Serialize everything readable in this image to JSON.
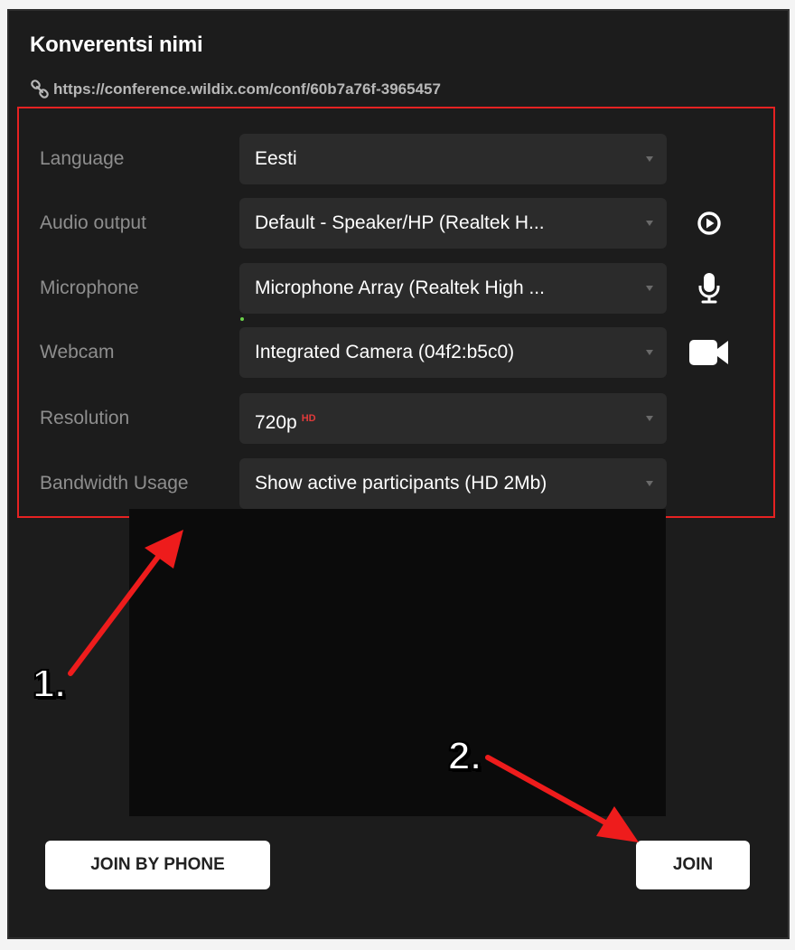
{
  "header": {
    "title": "Konverentsi nimi",
    "link_icon": "link-icon",
    "link_url": "https://conference.wildix.com/conf/60b7a76f-3965457"
  },
  "settings": {
    "rows": [
      {
        "label": "Language",
        "value": "Eesti"
      },
      {
        "label": "Audio output",
        "value": "Default - Speaker/HP (Realtek H...",
        "icon": "play-circle-icon"
      },
      {
        "label": "Microphone",
        "value": "Microphone Array (Realtek High ...",
        "icon": "microphone-icon"
      },
      {
        "label": "Webcam",
        "value": "Integrated Camera (04f2:b5c0)",
        "icon": "video-camera-icon"
      },
      {
        "label": "Resolution",
        "value": "720p",
        "badge": "HD"
      },
      {
        "label": "Bandwidth Usage",
        "value": "Show active participants (HD 2Mb)"
      }
    ]
  },
  "buttons": {
    "join_by_phone": "JOIN BY PHONE",
    "join": "JOIN"
  },
  "annotations": {
    "step1": "1.",
    "step2": "2."
  },
  "colors": {
    "panel_bg": "#1c1c1c",
    "select_bg": "#2b2b2b",
    "highlight_border": "#e52222",
    "hd_badge": "#e03a3a",
    "mic_level": "#6ad04a",
    "arrow": "#ee1c1c"
  }
}
